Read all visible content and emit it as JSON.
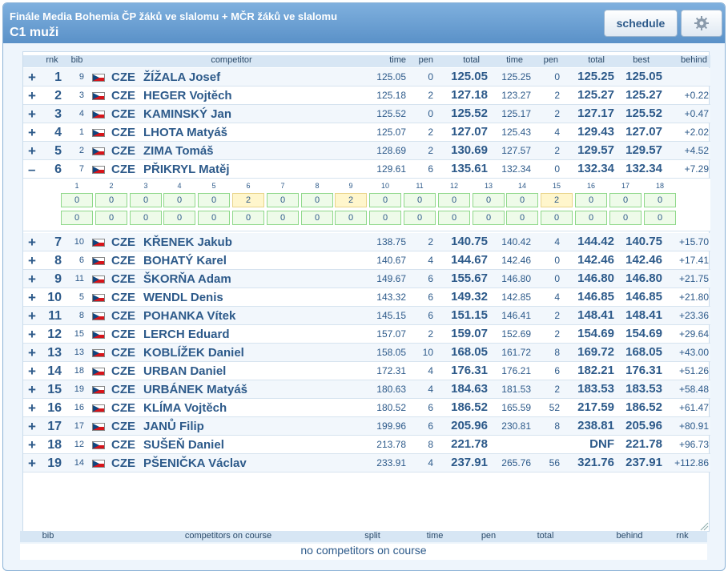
{
  "header": {
    "title": "Finále Media Bohemia ČP žáků ve slalomu + MČR žáků ve slalomu",
    "category": "C1 muži",
    "schedule_label": "schedule",
    "settings_icon": "gear-icon"
  },
  "columns": {
    "rnk": "rnk",
    "bib": "bib",
    "competitor": "competitor",
    "time1": "time",
    "pen1": "pen",
    "total1": "total",
    "time2": "time",
    "pen2": "pen",
    "total2": "total",
    "best": "best",
    "behind": "behind"
  },
  "rows": [
    {
      "toggle": "+",
      "rnk": "1",
      "bib": "9",
      "nat": "CZE",
      "name": "ŽÍŽALA Josef",
      "time1": "125.05",
      "pen1": "0",
      "total1": "125.05",
      "time2": "125.25",
      "pen2": "0",
      "total2": "125.25",
      "best": "125.05",
      "behind": ""
    },
    {
      "toggle": "+",
      "rnk": "2",
      "bib": "3",
      "nat": "CZE",
      "name": "HEGER Vojtěch",
      "time1": "125.18",
      "pen1": "2",
      "total1": "127.18",
      "time2": "123.27",
      "pen2": "2",
      "total2": "125.27",
      "best": "125.27",
      "behind": "+0.22"
    },
    {
      "toggle": "+",
      "rnk": "3",
      "bib": "4",
      "nat": "CZE",
      "name": "KAMINSKÝ Jan",
      "time1": "125.52",
      "pen1": "0",
      "total1": "125.52",
      "time2": "125.17",
      "pen2": "2",
      "total2": "127.17",
      "best": "125.52",
      "behind": "+0.47"
    },
    {
      "toggle": "+",
      "rnk": "4",
      "bib": "1",
      "nat": "CZE",
      "name": "LHOTA Matyáš",
      "time1": "125.07",
      "pen1": "2",
      "total1": "127.07",
      "time2": "125.43",
      "pen2": "4",
      "total2": "129.43",
      "best": "127.07",
      "behind": "+2.02"
    },
    {
      "toggle": "+",
      "rnk": "5",
      "bib": "2",
      "nat": "CZE",
      "name": "ZIMA Tomáš",
      "time1": "128.69",
      "pen1": "2",
      "total1": "130.69",
      "time2": "127.57",
      "pen2": "2",
      "total2": "129.57",
      "best": "129.57",
      "behind": "+4.52"
    },
    {
      "toggle": "–",
      "rnk": "6",
      "bib": "7",
      "nat": "CZE",
      "name": "PŘIKRYL Matěj",
      "time1": "129.61",
      "pen1": "6",
      "total1": "135.61",
      "time2": "132.34",
      "pen2": "0",
      "total2": "132.34",
      "best": "132.34",
      "behind": "+7.29"
    },
    {
      "toggle": "+",
      "rnk": "7",
      "bib": "10",
      "nat": "CZE",
      "name": "KŘENEK Jakub",
      "time1": "138.75",
      "pen1": "2",
      "total1": "140.75",
      "time2": "140.42",
      "pen2": "4",
      "total2": "144.42",
      "best": "140.75",
      "behind": "+15.70"
    },
    {
      "toggle": "+",
      "rnk": "8",
      "bib": "6",
      "nat": "CZE",
      "name": "BOHATÝ Karel",
      "time1": "140.67",
      "pen1": "4",
      "total1": "144.67",
      "time2": "142.46",
      "pen2": "0",
      "total2": "142.46",
      "best": "142.46",
      "behind": "+17.41"
    },
    {
      "toggle": "+",
      "rnk": "9",
      "bib": "11",
      "nat": "CZE",
      "name": "ŠKORŇA Adam",
      "time1": "149.67",
      "pen1": "6",
      "total1": "155.67",
      "time2": "146.80",
      "pen2": "0",
      "total2": "146.80",
      "best": "146.80",
      "behind": "+21.75"
    },
    {
      "toggle": "+",
      "rnk": "10",
      "bib": "5",
      "nat": "CZE",
      "name": "WENDL Denis",
      "time1": "143.32",
      "pen1": "6",
      "total1": "149.32",
      "time2": "142.85",
      "pen2": "4",
      "total2": "146.85",
      "best": "146.85",
      "behind": "+21.80"
    },
    {
      "toggle": "+",
      "rnk": "11",
      "bib": "8",
      "nat": "CZE",
      "name": "POHANKA Vítek",
      "time1": "145.15",
      "pen1": "6",
      "total1": "151.15",
      "time2": "146.41",
      "pen2": "2",
      "total2": "148.41",
      "best": "148.41",
      "behind": "+23.36"
    },
    {
      "toggle": "+",
      "rnk": "12",
      "bib": "15",
      "nat": "CZE",
      "name": "LERCH Eduard",
      "time1": "157.07",
      "pen1": "2",
      "total1": "159.07",
      "time2": "152.69",
      "pen2": "2",
      "total2": "154.69",
      "best": "154.69",
      "behind": "+29.64"
    },
    {
      "toggle": "+",
      "rnk": "13",
      "bib": "13",
      "nat": "CZE",
      "name": "KOBLÍŽEK Daniel",
      "time1": "158.05",
      "pen1": "10",
      "total1": "168.05",
      "time2": "161.72",
      "pen2": "8",
      "total2": "169.72",
      "best": "168.05",
      "behind": "+43.00"
    },
    {
      "toggle": "+",
      "rnk": "14",
      "bib": "18",
      "nat": "CZE",
      "name": "URBAN Daniel",
      "time1": "172.31",
      "pen1": "4",
      "total1": "176.31",
      "time2": "176.21",
      "pen2": "6",
      "total2": "182.21",
      "best": "176.31",
      "behind": "+51.26"
    },
    {
      "toggle": "+",
      "rnk": "15",
      "bib": "19",
      "nat": "CZE",
      "name": "URBÁNEK Matyáš",
      "time1": "180.63",
      "pen1": "4",
      "total1": "184.63",
      "time2": "181.53",
      "pen2": "2",
      "total2": "183.53",
      "best": "183.53",
      "behind": "+58.48"
    },
    {
      "toggle": "+",
      "rnk": "16",
      "bib": "16",
      "nat": "CZE",
      "name": "KLÍMA Vojtěch",
      "time1": "180.52",
      "pen1": "6",
      "total1": "186.52",
      "time2": "165.59",
      "pen2": "52",
      "total2": "217.59",
      "best": "186.52",
      "behind": "+61.47"
    },
    {
      "toggle": "+",
      "rnk": "17",
      "bib": "17",
      "nat": "CZE",
      "name": "JANŮ Filip",
      "time1": "199.96",
      "pen1": "6",
      "total1": "205.96",
      "time2": "230.81",
      "pen2": "8",
      "total2": "238.81",
      "best": "205.96",
      "behind": "+80.91"
    },
    {
      "toggle": "+",
      "rnk": "18",
      "bib": "12",
      "nat": "CZE",
      "name": "SUŠEŇ Daniel",
      "time1": "213.78",
      "pen1": "8",
      "total1": "221.78",
      "time2": "",
      "pen2": "",
      "total2": "DNF",
      "best": "221.78",
      "behind": "+96.73"
    },
    {
      "toggle": "+",
      "rnk": "19",
      "bib": "14",
      "nat": "CZE",
      "name": "PŠENIČKA Václav",
      "time1": "233.91",
      "pen1": "4",
      "total1": "237.91",
      "time2": "265.76",
      "pen2": "56",
      "total2": "321.76",
      "best": "237.91",
      "behind": "+112.86"
    }
  ],
  "gates": {
    "numbers": [
      "1",
      "2",
      "3",
      "4",
      "5",
      "6",
      "7",
      "8",
      "9",
      "10",
      "11",
      "12",
      "13",
      "14",
      "15",
      "16",
      "17",
      "18"
    ],
    "run1": [
      "0",
      "0",
      "0",
      "0",
      "0",
      "2",
      "0",
      "0",
      "2",
      "0",
      "0",
      "0",
      "0",
      "0",
      "2",
      "0",
      "0",
      "0"
    ],
    "run2": [
      "0",
      "0",
      "0",
      "0",
      "0",
      "0",
      "0",
      "0",
      "0",
      "0",
      "0",
      "0",
      "0",
      "0",
      "0",
      "0",
      "0",
      "0"
    ]
  },
  "footer": {
    "bib": "bib",
    "competitors_on_course": "competitors on course",
    "split": "split",
    "time": "time",
    "pen": "pen",
    "total": "total",
    "behind": "behind",
    "rnk": "rnk",
    "empty_message": "no competitors on course"
  },
  "colors": {
    "titlebar": "#5a91c8",
    "text": "#2d5a8a",
    "gate_clean": "#eefbe9",
    "gate_penalty": "#fff6cc",
    "flag_red": "#d7141a",
    "flag_blue": "#11457e"
  }
}
